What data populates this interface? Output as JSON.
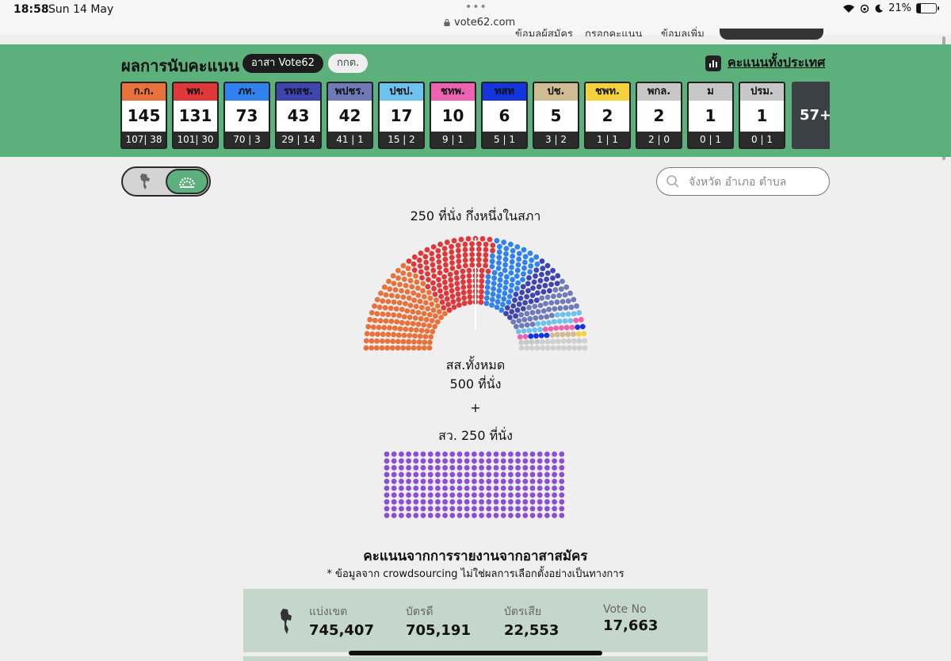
{
  "status_bar": {
    "time": "18:58",
    "date": "Sun 14 May",
    "url": "vote62.com",
    "battery": "21%"
  },
  "nav_ghost": [
    "ข้อมูลผู้สมัคร",
    "กรอกคะแนน",
    "ข้อมูลเพิ่ม"
  ],
  "header": {
    "title": "ผลการนับคะแนน",
    "source_active": "อาสา Vote62",
    "source_other": "กกต.",
    "country_link": "คะแนนทั้งประเทศ"
  },
  "parties": [
    {
      "abbr": "ก.ก.",
      "total": "145",
      "split": "107| 38",
      "color": "#e8713c"
    },
    {
      "abbr": "พท.",
      "total": "131",
      "split": "101| 30",
      "color": "#e0383a"
    },
    {
      "abbr": "ภท.",
      "total": "73",
      "split": "70 |  3",
      "color": "#2f82f0"
    },
    {
      "abbr": "รทสช.",
      "total": "43",
      "split": "29 | 14",
      "color": "#3f45b0"
    },
    {
      "abbr": "พปชร.",
      "total": "42",
      "split": "41 |  1",
      "color": "#6f7ab8"
    },
    {
      "abbr": "ปชป.",
      "total": "17",
      "split": "15 |  2",
      "color": "#6ec3ee"
    },
    {
      "abbr": "ชทพ.",
      "total": "10",
      "split": "9 | 1",
      "color": "#ee62b2"
    },
    {
      "abbr": "ทสท",
      "total": "6",
      "split": "5 | 1",
      "color": "#1434de"
    },
    {
      "abbr": "ปช.",
      "total": "5",
      "split": "3 | 2",
      "color": "#cfbc93"
    },
    {
      "abbr": "ชพท.",
      "total": "2",
      "split": "1 | 1",
      "color": "#f6d23a"
    },
    {
      "abbr": "พกล.",
      "total": "2",
      "split": "2 | 0",
      "color": "#c7c7c7"
    },
    {
      "abbr": "ม",
      "total": "1",
      "split": "0 | 1",
      "color": "#c7c7c7"
    },
    {
      "abbr": "ปรม.",
      "total": "1",
      "split": "0 | 1",
      "color": "#c7c7c7"
    }
  ],
  "more_label": "57+",
  "search": {
    "placeholder": "จังหวัด อำเภอ ตำบล"
  },
  "parliament": {
    "title": "250 ที่นั่ง กึ่งหนึ่งในสภา",
    "total_line1": "สส.ทั้งหมด",
    "total_line2": "500 ที่นั่ง",
    "plus": "+",
    "senate_label": "สว. 250 ที่นั่ง",
    "senate_seats": 250,
    "senate_color": "#8a4fd8",
    "other_color": "#cfcfcf"
  },
  "report": {
    "title": "คะแนนจากการรายงานจากอาสาสมัคร",
    "subtitle": "* ข้อมูลจาก crowdsourcing ไม่ใช่ผลการเลือกตั้งอย่างเป็นทางการ",
    "stats": [
      {
        "label": "แบ่งเขต",
        "value": "745,407"
      },
      {
        "label": "บัตรดี",
        "value": "705,191"
      },
      {
        "label": "บัตรเสีย",
        "value": "22,553"
      },
      {
        "label": "Vote No",
        "value": "17,663"
      }
    ]
  }
}
